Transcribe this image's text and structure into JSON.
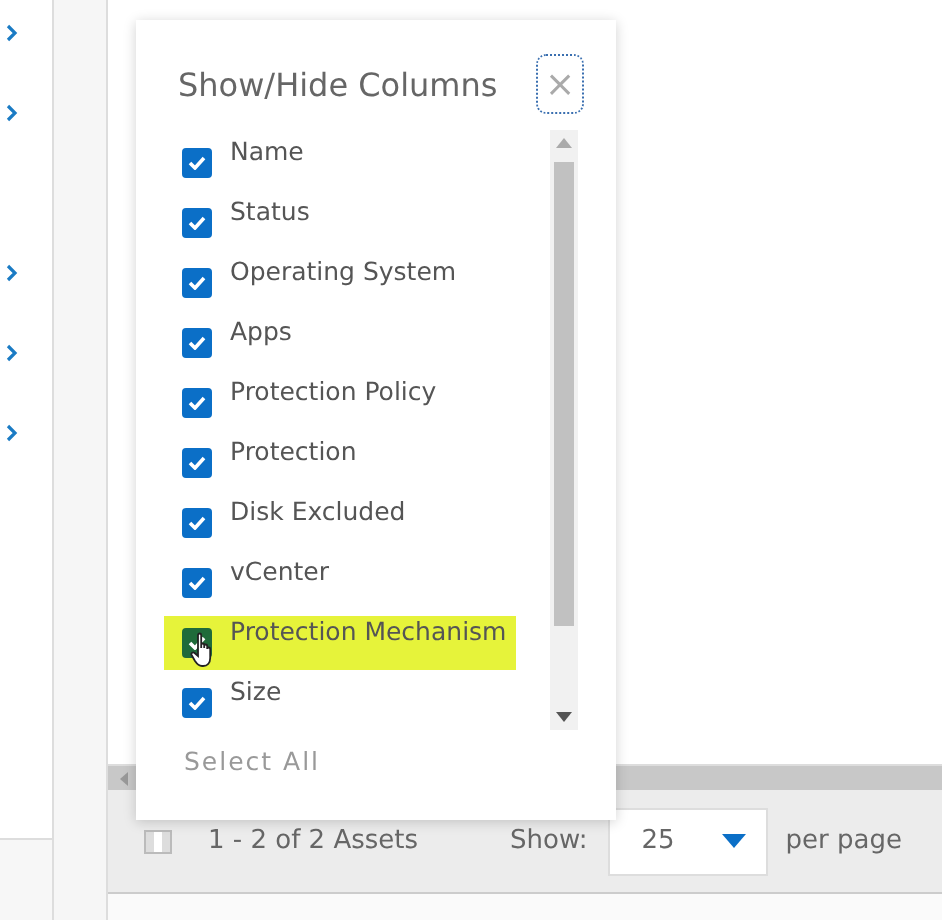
{
  "sidebar": {
    "items": [
      {
        "kind": "chevron"
      },
      {
        "kind": "chevron"
      },
      {
        "kind": "gap"
      },
      {
        "kind": "chevron"
      },
      {
        "kind": "chevron"
      },
      {
        "kind": "chevron"
      }
    ]
  },
  "dialog": {
    "title": "Show/Hide Columns",
    "close": "×",
    "columns": [
      {
        "label": "Name",
        "checked": true,
        "selected": false
      },
      {
        "label": "Status",
        "checked": true,
        "selected": false
      },
      {
        "label": "Operating System",
        "checked": true,
        "selected": false
      },
      {
        "label": "Apps",
        "checked": true,
        "selected": false
      },
      {
        "label": "Protection Policy",
        "checked": true,
        "selected": false
      },
      {
        "label": "Protection",
        "checked": true,
        "selected": false
      },
      {
        "label": "Disk Excluded",
        "checked": true,
        "selected": false
      },
      {
        "label": "vCenter",
        "checked": true,
        "selected": false
      },
      {
        "label": "Protection Mechanism",
        "checked": true,
        "selected": true
      },
      {
        "label": "Size",
        "checked": true,
        "selected": false
      }
    ],
    "select_all": "Select All"
  },
  "footer": {
    "count": "1 - 2 of 2 Assets",
    "show_label": "Show:",
    "page_size": "25",
    "per_page": "per page"
  }
}
